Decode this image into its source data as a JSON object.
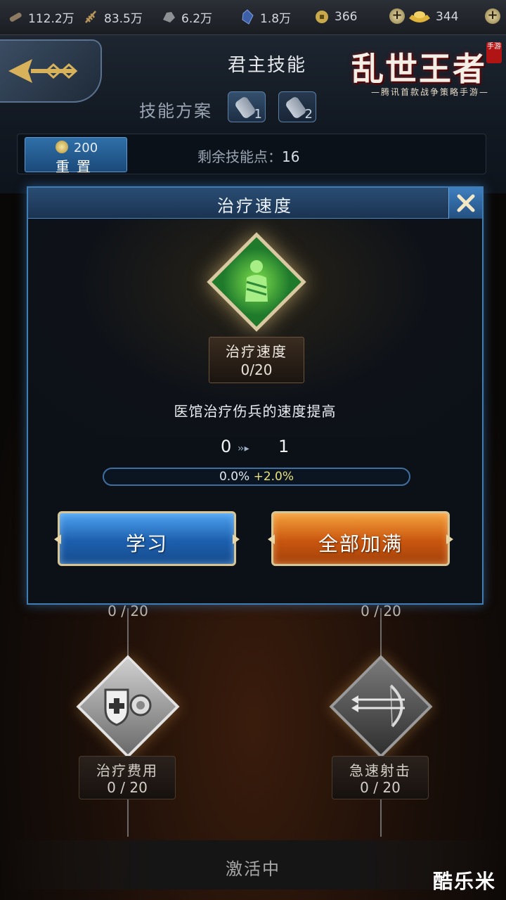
{
  "resources": [
    {
      "icon": "wood-icon",
      "value": "112.2万"
    },
    {
      "icon": "grain-icon",
      "value": "83.5万"
    },
    {
      "icon": "stone-icon",
      "value": "6.2万"
    },
    {
      "icon": "iron-icon",
      "value": "1.8万"
    },
    {
      "icon": "copper-coin-icon",
      "value": "366"
    },
    {
      "icon": "gold-ingot-icon",
      "value": "344"
    }
  ],
  "header": {
    "title": "君主技能",
    "logo_text": "乱世王者",
    "logo_subtitle": "—腾讯首款战争策略手游—",
    "logo_tag": "手游",
    "scheme_label": "技能方案",
    "schemes": [
      "1",
      "2"
    ],
    "reset_cost": "200",
    "reset_label": "重置",
    "points_label": "剩余技能点：",
    "points_value": "16"
  },
  "tree": {
    "nodes": [
      {
        "name": "治疗费用",
        "level": "0 / 20"
      },
      {
        "name": "急速射击",
        "level": "0 / 20"
      }
    ],
    "partial_level_left": "0 / 20",
    "partial_level_right": "0 / 20",
    "status": "激活中"
  },
  "modal": {
    "title": "治疗速度",
    "skill_name": "治疗速度",
    "skill_level": "0/20",
    "description": "医馆治疗伤兵的速度提高",
    "level_from": "0",
    "level_to": "1",
    "progress_current": "0.0%",
    "progress_bonus": "+2.0%",
    "progress_fraction": 0.0,
    "learn_label": "学习",
    "max_label": "全部加满"
  },
  "watermark": "酷乐米",
  "colors": {
    "accent_blue": "#3f7db3",
    "learn_button": "#1c5fae",
    "max_button": "#c9560f",
    "bonus_text": "#e8e07a"
  }
}
